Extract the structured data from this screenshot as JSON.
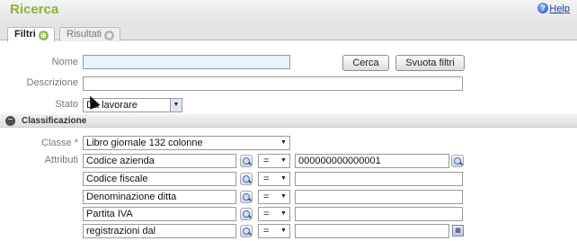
{
  "header": {
    "title": "Ricerca",
    "help_label": "Help",
    "help_icon": "question-circle-icon"
  },
  "tabs": [
    {
      "label": "Filtri",
      "active": true,
      "icon": "filter-circle-icon"
    },
    {
      "label": "Risultati",
      "active": false,
      "icon": "filter-circle-icon"
    }
  ],
  "filters": {
    "nome_label": "Nome",
    "nome_value": "",
    "descrizione_label": "Descrizione",
    "descrizione_value": "",
    "stato_label": "Stato",
    "stato_value": "Da lavorare",
    "search_button": "Cerca",
    "clear_button": "Svuota filtri"
  },
  "classification": {
    "section_title": "Classificazione",
    "classe_label": "Classe *",
    "classe_value": "Libro giornale 132 colonne",
    "attributi_label": "Attributi",
    "attributes": [
      {
        "name": "Codice azienda",
        "operator": "=",
        "value": "000000000000001"
      },
      {
        "name": "Codice fiscale",
        "operator": "=",
        "value": ""
      },
      {
        "name": "Denominazione ditta",
        "operator": "=",
        "value": ""
      },
      {
        "name": "Partita IVA",
        "operator": "=",
        "value": ""
      },
      {
        "name": "registrazioni dal",
        "operator": "=",
        "value": ""
      }
    ]
  },
  "colors": {
    "title": "#8db43a",
    "link": "#1a3f99",
    "accent_icon": "#8fbf55"
  }
}
